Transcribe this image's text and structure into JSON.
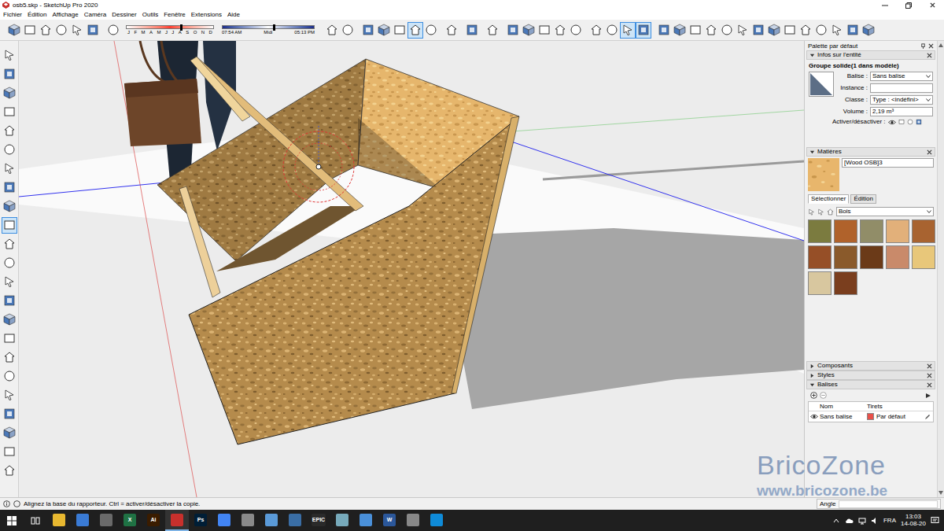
{
  "window": {
    "title": "osb5.skp - SketchUp Pro 2020"
  },
  "menu": [
    "Fichier",
    "Édition",
    "Affichage",
    "Caméra",
    "Dessiner",
    "Outils",
    "Fenêtre",
    "Extensions",
    "Aide"
  ],
  "toolbar": {
    "before_shadows": [
      [
        {
          "selected": false
        },
        {
          "selected": false
        },
        {
          "selected": false
        },
        {
          "selected": false
        },
        {
          "selected": false
        },
        {
          "selected": false
        }
      ],
      [
        {
          "selected": false
        }
      ]
    ],
    "shadows": {
      "months": [
        "J",
        "F",
        "M",
        "A",
        "M",
        "J",
        "J",
        "A",
        "S",
        "O",
        "N",
        "D"
      ],
      "date_level": 0.62,
      "sunrise": "07:54 AM",
      "noon": "Midi",
      "sunset": "05:13 PM",
      "time_level": 0.55
    },
    "after_shadows": [
      [
        {
          "selected": false
        },
        {
          "selected": false
        }
      ],
      [
        {
          "selected": false
        },
        {
          "selected": false
        },
        {
          "selected": false
        },
        {
          "selected": true
        },
        {
          "selected": false
        }
      ],
      [
        {
          "selected": false
        }
      ],
      [
        {
          "selected": false
        }
      ],
      [
        {
          "selected": false
        }
      ],
      [
        {
          "selected": false
        },
        {
          "selected": false
        },
        {
          "selected": false
        },
        {
          "selected": false
        },
        {
          "selected": false
        }
      ],
      [
        {
          "selected": false
        },
        {
          "selected": false
        },
        {
          "selected": true
        },
        {
          "selected": true
        }
      ],
      [
        {
          "selected": false
        },
        {
          "selected": false
        },
        {
          "selected": false
        },
        {
          "selected": false
        },
        {
          "selected": false
        },
        {
          "selected": false
        },
        {
          "selected": false
        },
        {
          "selected": false
        },
        {
          "selected": false
        },
        {
          "selected": false
        },
        {
          "selected": false
        },
        {
          "selected": false
        },
        {
          "selected": false
        },
        {
          "selected": false
        }
      ]
    ]
  },
  "left_tools": [
    {
      "selected": false
    },
    {
      "selected": false
    },
    {
      "selected": false
    },
    {
      "selected": false
    },
    {
      "selected": false
    },
    {
      "selected": false
    },
    {
      "selected": false
    },
    {
      "selected": false
    },
    {
      "selected": false
    },
    {
      "selected": true
    },
    {
      "selected": false
    },
    {
      "selected": false
    },
    {
      "selected": false
    },
    {
      "selected": false
    },
    {
      "selected": false
    },
    {
      "selected": false
    },
    {
      "selected": false
    },
    {
      "selected": false
    },
    {
      "selected": false
    },
    {
      "selected": false
    },
    {
      "selected": false
    },
    {
      "selected": false
    },
    {
      "selected": false
    }
  ],
  "palette": {
    "title": "Palette par défaut",
    "entity_info": {
      "header": "Infos sur l'entité",
      "expanded": true,
      "title": "Groupe solide(1 dans modèle)",
      "fields": [
        {
          "label": "Balise :",
          "value": "Sans balise",
          "kind": "select"
        },
        {
          "label": "Instance :",
          "value": "",
          "kind": "input"
        },
        {
          "label": "Classe :",
          "value": "Type : <indéfini>",
          "kind": "select"
        },
        {
          "label": "Volume :",
          "value": "2,19 m³",
          "kind": "input"
        }
      ],
      "toggle_label": "Activer/désactiver :"
    },
    "materials": {
      "header": "Matières",
      "expanded": true,
      "name": "[Wood OSB]3",
      "tabs": [
        {
          "label": "Sélectionner",
          "selected": true
        },
        {
          "label": "Édition",
          "selected": false
        }
      ],
      "library": "Bois",
      "swatches": [
        {
          "color": "#7b7b3f"
        },
        {
          "color": "#b0622b"
        },
        {
          "color": "#918d68"
        },
        {
          "color": "#e2b07a"
        },
        {
          "color": "#a86330"
        },
        {
          "color": "#964f27"
        },
        {
          "color": "#8a5a2b"
        },
        {
          "color": "#6b3a18"
        },
        {
          "color": "#c98a6a"
        },
        {
          "color": "#e8c77a"
        },
        {
          "color": "#d8c79f"
        },
        {
          "color": "#7a3e1e"
        }
      ]
    },
    "sections": [
      {
        "label": "Composants",
        "expanded": false
      },
      {
        "label": "Styles",
        "expanded": false
      },
      {
        "label": "Balises",
        "expanded": true
      }
    ],
    "tags": {
      "columns": [
        "Nom",
        "Tirets"
      ],
      "rows": [
        {
          "name": "Sans balise",
          "visible": true,
          "dashes": "Par défaut",
          "color": "#e8504a"
        }
      ]
    }
  },
  "status": {
    "text": "Alignez la base du rapporteur. Ctrl = activer/désactiver la copie.",
    "measure_label": "Angle",
    "measure_value": ""
  },
  "taskbar": {
    "apps": [
      {
        "label": "",
        "color": "#e8b830",
        "active": false
      },
      {
        "label": "",
        "color": "#3a7bd5",
        "active": false
      },
      {
        "label": "",
        "color": "#6a6a6a",
        "active": false
      },
      {
        "label": "X",
        "color": "#1f7244",
        "active": false
      },
      {
        "label": "Ai",
        "color": "#3a1c00",
        "active": false
      },
      {
        "label": "",
        "color": "#c8302c",
        "active": true
      },
      {
        "label": "Ps",
        "color": "#001e36",
        "active": false
      },
      {
        "label": "",
        "color": "#4285f4",
        "active": false
      },
      {
        "label": "",
        "color": "#8a8a8a",
        "active": false
      },
      {
        "label": "",
        "color": "#5a9ad8",
        "active": false
      },
      {
        "label": "",
        "color": "#3a6ea5",
        "active": false
      },
      {
        "label": "EPIC",
        "color": "#2a2a2a",
        "active": false
      },
      {
        "label": "",
        "color": "#77aabb",
        "active": false
      },
      {
        "label": "",
        "color": "#4a90d9",
        "active": false
      },
      {
        "label": "W",
        "color": "#2b579a",
        "active": false
      },
      {
        "label": "",
        "color": "#888888",
        "active": false
      },
      {
        "label": "",
        "color": "#0f8bd8",
        "active": false
      }
    ],
    "language": "FRA",
    "time": "13:03",
    "date": "14-08-20"
  },
  "watermark": {
    "brand": "BricoZone",
    "url": "www.bricozone.be"
  }
}
